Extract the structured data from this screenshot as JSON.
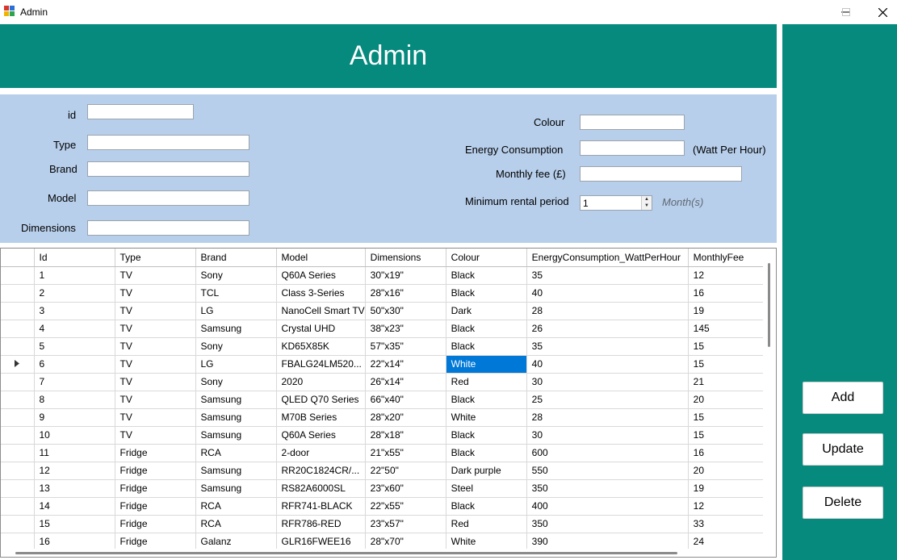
{
  "window": {
    "title": "Admin"
  },
  "header": {
    "title": "Admin"
  },
  "form": {
    "id_label": "id",
    "type_label": "Type",
    "brand_label": "Brand",
    "model_label": "Model",
    "dimensions_label": "Dimensions",
    "colour_label": "Colour",
    "energy_label": "Energy Consumption",
    "energy_unit": "(Watt Per Hour)",
    "monthly_fee_label": "Monthly fee (£)",
    "min_rental_label": "Minimum rental period",
    "min_rental_value": "1",
    "min_rental_unit": "Month(s)",
    "id_value": "",
    "type_value": "",
    "brand_value": "",
    "model_value": "",
    "dimensions_value": "",
    "colour_value": "",
    "energy_value": "",
    "monthly_fee_value": ""
  },
  "actions": {
    "add": "Add",
    "update": "Update",
    "delete": "Delete"
  },
  "grid": {
    "columns": [
      "Id",
      "Type",
      "Brand",
      "Model",
      "Dimensions",
      "Colour",
      "EnergyConsumption_WattPerHour",
      "MonthlyFee"
    ],
    "current_row_index": 5,
    "selected_cell": {
      "row": 5,
      "col": 5
    },
    "rows": [
      [
        "1",
        "TV",
        "Sony",
        "Q60A Series",
        "30\"x19\"",
        "Black",
        "35",
        "12"
      ],
      [
        "2",
        "TV",
        "TCL",
        "Class 3-Series",
        "28\"x16\"",
        "Black",
        "40",
        "16"
      ],
      [
        "3",
        "TV",
        "LG",
        "NanoCell Smart TV",
        "50\"x30\"",
        "Dark",
        "28",
        "19"
      ],
      [
        "4",
        "TV",
        "Samsung",
        "Crystal UHD",
        "38\"x23\"",
        "Black",
        "26",
        "145"
      ],
      [
        "5",
        "TV",
        "Sony",
        "KD65X85K",
        "57\"x35\"",
        "Black",
        "35",
        "15"
      ],
      [
        "6",
        "TV",
        "LG",
        "FBALG24LM520...",
        "22\"x14\"",
        "White",
        "40",
        "15"
      ],
      [
        "7",
        "TV",
        "Sony",
        "2020",
        "26\"x14\"",
        "Red",
        "30",
        "21"
      ],
      [
        "8",
        "TV",
        "Samsung",
        "QLED Q70 Series",
        "66\"x40\"",
        "Black",
        "25",
        "20"
      ],
      [
        "9",
        "TV",
        "Samsung",
        "M70B Series",
        "28\"x20\"",
        "White",
        "28",
        "15"
      ],
      [
        "10",
        "TV",
        "Samsung",
        "Q60A Series",
        "28\"x18\"",
        "Black",
        "30",
        "15"
      ],
      [
        "11",
        "Fridge",
        "RCA",
        "2-door",
        "21\"x55\"",
        "Black",
        "600",
        "16"
      ],
      [
        "12",
        "Fridge",
        "Samsung",
        "RR20C1824CR/...",
        "22\"50\"",
        "Dark purple",
        "550",
        "20"
      ],
      [
        "13",
        "Fridge",
        "Samsung",
        "RS82A6000SL",
        "23\"x60\"",
        "Steel",
        "350",
        "19"
      ],
      [
        "14",
        "Fridge",
        "RCA",
        "RFR741-BLACK",
        "22\"x55\"",
        "Black",
        "400",
        "12"
      ],
      [
        "15",
        "Fridge",
        "RCA",
        "RFR786-RED",
        "23\"x57\"",
        "Red",
        "350",
        "33"
      ],
      [
        "16",
        "Fridge",
        "Galanz",
        "GLR16FWEE16",
        "28\"x70\"",
        "White",
        "390",
        "24"
      ]
    ]
  },
  "colors": {
    "header_bg": "#068a7d",
    "form_bg": "#b8cfeb",
    "selection": "#0078d7"
  }
}
